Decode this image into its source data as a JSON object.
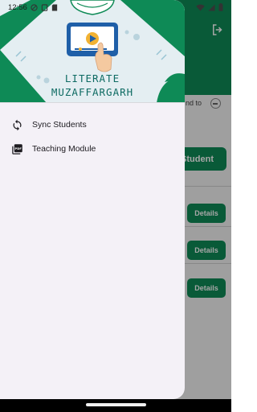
{
  "status_bar": {
    "time": "12:56",
    "icons": [
      "do-not-disturb-icon",
      "screenshot-icon",
      "sd-card-icon",
      "wifi-icon",
      "signal-icon",
      "battery-icon"
    ]
  },
  "app_background": {
    "add_button_label": "Student",
    "hint_text": "nd to",
    "details_label": "Details",
    "details_count": 3,
    "colors": {
      "primary": "#0e8a56"
    }
  },
  "drawer": {
    "brand": {
      "line1": "LITERATE",
      "line2": "MUZAFFARGARH"
    },
    "colors": {
      "header_green": "#0e8a56",
      "brand_text": "#0e6b63",
      "surface": "#f4f1f7"
    },
    "items": [
      {
        "label": "Sync Students",
        "icon": "sync-icon"
      },
      {
        "label": "Teaching Module",
        "icon": "pdf-icon"
      }
    ]
  }
}
